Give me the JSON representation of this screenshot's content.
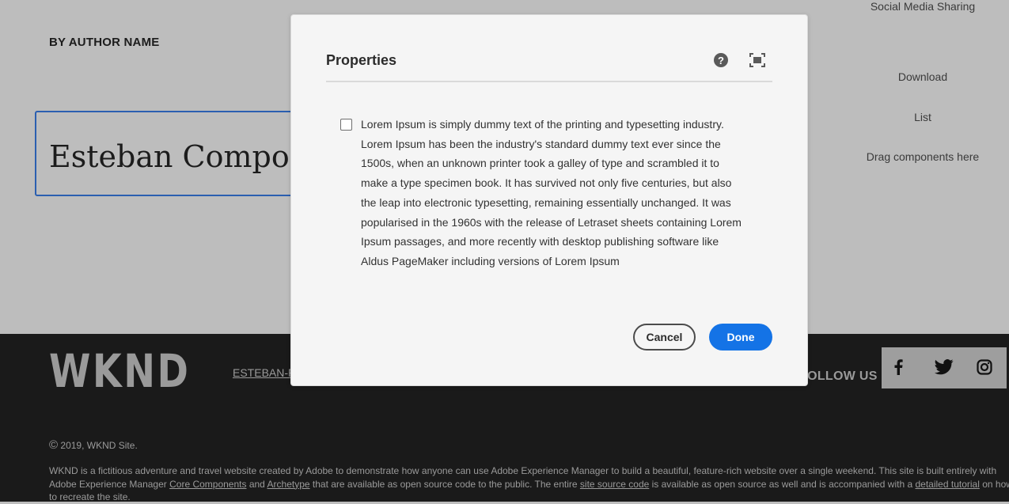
{
  "page": {
    "author": "BY AUTHOR NAME",
    "title": "Esteban Components",
    "side_links": [
      "Social Media Sharing",
      "Download",
      "List",
      "Drag components here"
    ]
  },
  "footer": {
    "logo": "WKND",
    "nav_link": "ESTEBAN-P",
    "follow_label": "FOLLOW US",
    "social_icons": [
      "facebook-icon",
      "twitter-icon",
      "instagram-icon"
    ],
    "copyright_symbol": "©",
    "copyright_text": "2019,  WKND Site.",
    "desc_line1": "WKND is a fictitious adventure and travel website created by Adobe to demonstrate how anyone can use Adobe Experience Manager to build a beautiful, feature-rich website over a single weekend. This site is built entirely with",
    "desc_line2_a": "Adobe Experience Manager ",
    "desc_link_core": "Core Components",
    "desc_line2_b": " and ",
    "desc_link_archetype": "Archetype",
    "desc_line2_c": " that are available as open source code to the public. The entire ",
    "desc_link_source": "site source code",
    "desc_line2_d": " is available as open source as well and is accompanied with a ",
    "desc_link_tutorial": "detailed tutorial",
    "desc_line2_e": " on how",
    "desc_line3": "to recreate the site."
  },
  "dialog": {
    "title": "Properties",
    "help_label": "?",
    "checkbox_checked": false,
    "checkbox_text": "Lorem Ipsum is simply dummy text of the printing and typesetting industry. Lorem Ipsum has been the industry's standard dummy text ever since the 1500s, when an unknown printer took a galley of type and scrambled it to make a type specimen book. It has survived not only five centuries, but also the leap into electronic typesetting, remaining essentially unchanged. It was popularised in the 1960s with the release of Letraset sheets containing Lorem Ipsum passages, and more recently with desktop publishing software like Aldus PageMaker including versions of Lorem Ipsum",
    "cancel_label": "Cancel",
    "done_label": "Done"
  },
  "colors": {
    "primary_button": "#1473e6",
    "overlay": "#bdbdbd",
    "footer_bg": "#1a1a1a"
  }
}
